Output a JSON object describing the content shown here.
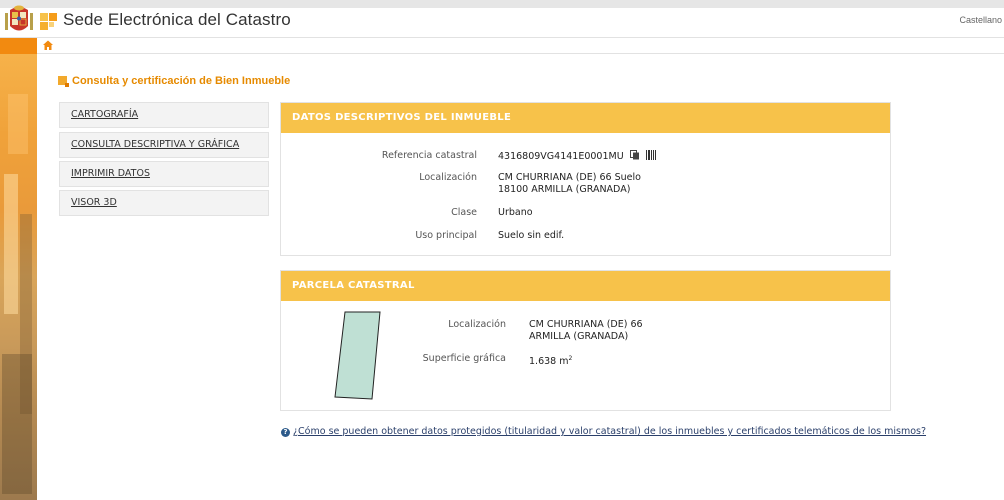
{
  "header": {
    "site_title": "Sede Electrónica del Catastro",
    "language": "Castellano"
  },
  "page": {
    "heading": "Consulta y certificación de Bien Inmueble"
  },
  "sidebar": {
    "items": [
      {
        "label": "CARTOGRAFÍA"
      },
      {
        "label": "CONSULTA DESCRIPTIVA Y GRÁFICA"
      },
      {
        "label": "IMPRIMIR DATOS"
      },
      {
        "label": "VISOR 3D"
      }
    ]
  },
  "datos": {
    "title": "DATOS DESCRIPTIVOS DEL INMUEBLE",
    "ref_label": "Referencia catastral",
    "ref_value": "4316809VG4141E0001MU",
    "loc_label": "Localización",
    "loc_line1": "CM CHURRIANA (DE) 66 Suelo",
    "loc_line2": "18100 ARMILLA (GRANADA)",
    "clase_label": "Clase",
    "clase_value": "Urbano",
    "uso_label": "Uso principal",
    "uso_value": "Suelo sin edif."
  },
  "parcela": {
    "title": "PARCELA CATASTRAL",
    "loc_label": "Localización",
    "loc_line1": "CM CHURRIANA (DE) 66",
    "loc_line2": "ARMILLA (GRANADA)",
    "sup_label": "Superficie gráfica",
    "sup_value": "1.638 m",
    "sup_unit_exp": "2"
  },
  "help": {
    "link_text": "¿Cómo se pueden obtener datos protegidos (titularidad y valor catastral) de los inmuebles y certificados telemáticos de los mismos?"
  },
  "colors": {
    "accent_orange": "#f28a10",
    "panel_header": "#f7c24a",
    "heading_text": "#e68a00",
    "parcel_fill": "#bfe0d4"
  }
}
